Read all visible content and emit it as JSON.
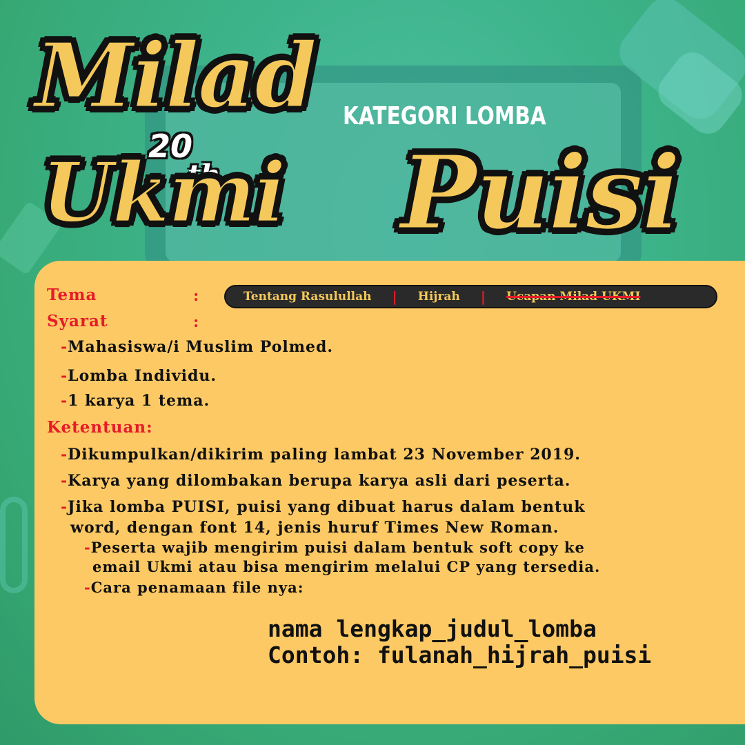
{
  "logo": {
    "line1": "Milad",
    "number": "20",
    "suffix": "th",
    "line2": "Ukmi"
  },
  "header": {
    "kategori": "KATEGORI LOMBA",
    "title": "Puisi"
  },
  "tema": {
    "label": "Tema",
    "colon": ":",
    "options": [
      "Tentang Rasulullah",
      "Hijrah",
      "Ucapan Milad UKMI"
    ],
    "separator": "|"
  },
  "syarat": {
    "label": "Syarat",
    "colon": ":",
    "items": [
      "Mahasiswa/i Muslim Polmed.",
      "Lomba Individu.",
      "1 karya 1 tema."
    ]
  },
  "ketentuan": {
    "label": "Ketentuan:",
    "items": [
      "Dikumpulkan/dikirim paling lambat 23 November 2019.",
      "Karya yang dilombakan berupa karya asli dari peserta.",
      "Jika lomba PUISI, puisi yang dibuat harus dalam bentuk",
      "word, dengan font 14, jenis huruf Times New Roman."
    ],
    "sub_items": [
      "Peserta wajib mengirim puisi dalam bentuk soft copy ke",
      "email Ukmi atau bisa mengirim melalui CP yang tersedia.",
      "Cara penamaan file nya:"
    ]
  },
  "dash": "-",
  "filename": {
    "format": "nama lengkap_judul_lomba",
    "example": "Contoh: fulanah_hijrah_puisi"
  },
  "colors": {
    "background": "#3aa877",
    "card": "#fdc964",
    "accent_red": "#e51c2a",
    "logo_yellow": "#f4c85a"
  }
}
